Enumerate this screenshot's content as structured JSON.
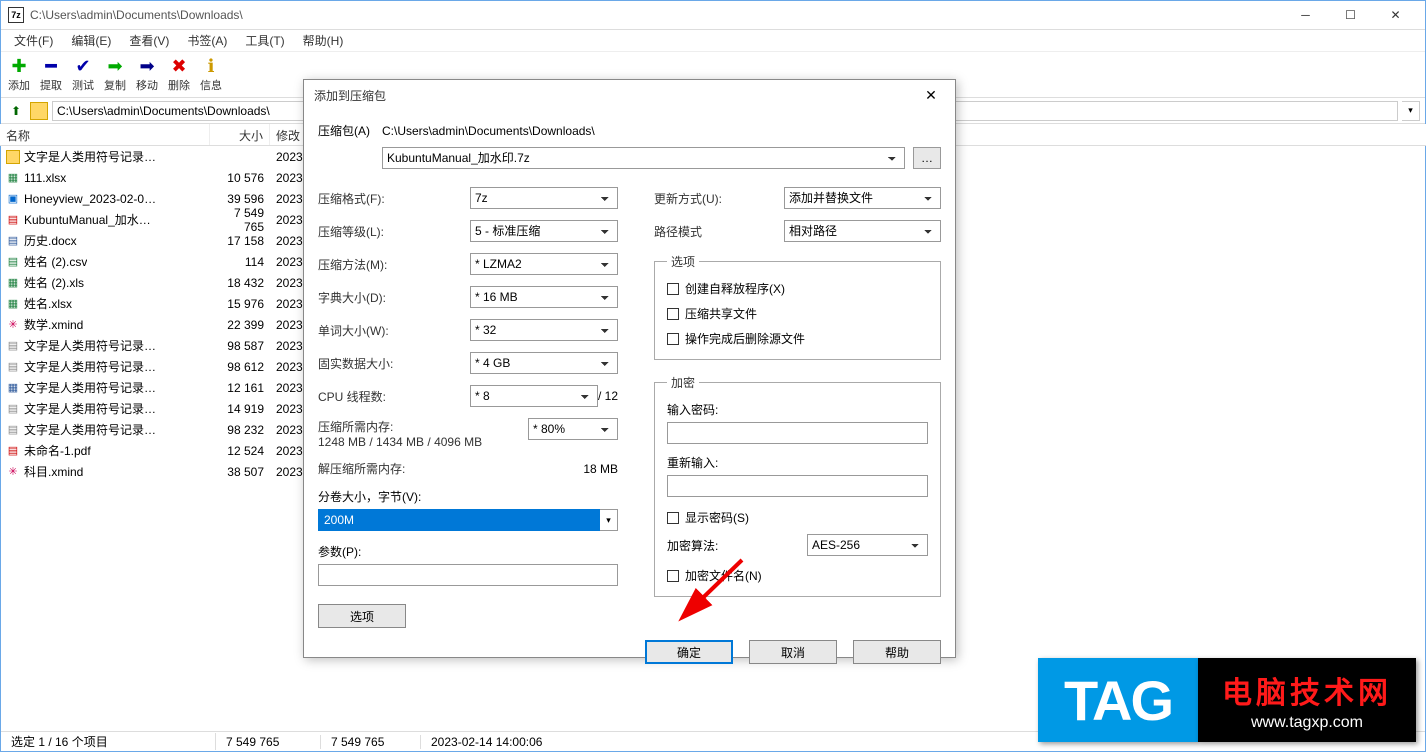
{
  "window": {
    "title": "C:\\Users\\admin\\Documents\\Downloads\\",
    "app_icon_text": "7z"
  },
  "menu": {
    "file": "文件(F)",
    "edit": "编辑(E)",
    "view": "查看(V)",
    "bookmarks": "书签(A)",
    "tools": "工具(T)",
    "help": "帮助(H)"
  },
  "toolbar": {
    "add": "添加",
    "extract": "提取",
    "test": "测试",
    "copy": "复制",
    "move": "移动",
    "delete": "删除",
    "info": "信息"
  },
  "path": "C:\\Users\\admin\\Documents\\Downloads\\",
  "columns": {
    "name": "名称",
    "size": "大小",
    "modified": "修改"
  },
  "files": [
    {
      "icon": "folder",
      "name": "文字是人类用符号记录…",
      "size": "",
      "date": "2023"
    },
    {
      "icon": "xlsx",
      "name": "111.xlsx",
      "size": "10 576",
      "date": "2023"
    },
    {
      "icon": "img",
      "name": "Honeyview_2023-02-0…",
      "size": "39 596",
      "date": "2023"
    },
    {
      "icon": "pdf",
      "name": "KubuntuManual_加水…",
      "size": "7 549 765",
      "date": "2023"
    },
    {
      "icon": "docx",
      "name": "历史.docx",
      "size": "17 158",
      "date": "2023"
    },
    {
      "icon": "csv",
      "name": "姓名 (2).csv",
      "size": "114",
      "date": "2023"
    },
    {
      "icon": "xls",
      "name": "姓名 (2).xls",
      "size": "18 432",
      "date": "2023"
    },
    {
      "icon": "xlsx",
      "name": "姓名.xlsx",
      "size": "15 976",
      "date": "2023"
    },
    {
      "icon": "xmind",
      "name": "数学.xmind",
      "size": "22 399",
      "date": "2023"
    },
    {
      "icon": "txt",
      "name": "文字是人类用符号记录…",
      "size": "98 587",
      "date": "2023"
    },
    {
      "icon": "txt",
      "name": "文字是人类用符号记录…",
      "size": "98 612",
      "date": "2023"
    },
    {
      "icon": "docx2",
      "name": "文字是人类用符号记录…",
      "size": "12 161",
      "date": "2023"
    },
    {
      "icon": "txt",
      "name": "文字是人类用符号记录…",
      "size": "14 919",
      "date": "2023"
    },
    {
      "icon": "txt",
      "name": "文字是人类用符号记录…",
      "size": "98 232",
      "date": "2023"
    },
    {
      "icon": "pdf",
      "name": "未命名-1.pdf",
      "size": "12 524",
      "date": "2023"
    },
    {
      "icon": "xmind",
      "name": "科目.xmind",
      "size": "38 507",
      "date": "2023"
    }
  ],
  "status": {
    "selected": "选定 1 / 16 个项目",
    "s1": "7 549 765",
    "s2": "7 549 765",
    "date": "2023-02-14 14:00:06"
  },
  "dialog": {
    "title": "添加到压缩包",
    "archive_label": "压缩包(A)",
    "archive_path": "C:\\Users\\admin\\Documents\\Downloads\\",
    "archive_name": "KubuntuManual_加水印.7z",
    "format_label": "压缩格式(F):",
    "format": "7z",
    "level_label": "压缩等级(L):",
    "level": "5 - 标准压缩",
    "method_label": "压缩方法(M):",
    "method": "*  LZMA2",
    "dict_label": "字典大小(D):",
    "dict": "*  16 MB",
    "word_label": "单词大小(W):",
    "word": "*  32",
    "solid_label": "固实数据大小:",
    "solid": "*  4 GB",
    "cpu_label": "CPU 线程数:",
    "cpu": "*  8",
    "cpu_max": "/ 12",
    "mem_c_label": "压缩所需内存:",
    "mem_c_value": "1248 MB / 1434 MB / 4096 MB",
    "mem_c_pct": "*  80%",
    "mem_d_label": "解压缩所需内存:",
    "mem_d_value": "18 MB",
    "volume_label": "分卷大小，字节(V):",
    "volume": "200M",
    "params_label": "参数(P):",
    "params": "",
    "options_btn": "选项",
    "update_label": "更新方式(U):",
    "update": "添加并替换文件",
    "pathmode_label": "路径模式",
    "pathmode": "相对路径",
    "options_group": "选项",
    "sfx": "创建自释放程序(X)",
    "shared": "压缩共享文件",
    "delete_after": "操作完成后删除源文件",
    "encrypt_group": "加密",
    "pwd_label": "输入密码:",
    "pwd2_label": "重新输入:",
    "show_pwd": "显示密码(S)",
    "enc_method_label": "加密算法:",
    "enc_method": "AES-256",
    "enc_names": "加密文件名(N)",
    "ok": "确定",
    "cancel": "取消",
    "help": "帮助"
  },
  "tag": {
    "left": "TAG",
    "title": "电脑技术网",
    "url": "www.tagxp.com"
  }
}
